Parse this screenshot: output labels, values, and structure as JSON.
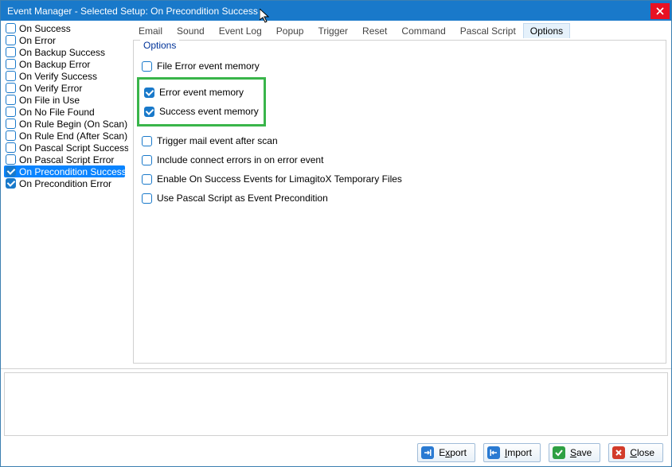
{
  "window": {
    "title": "Event Manager - Selected Setup: On Precondition Success"
  },
  "sidebar": {
    "items": [
      {
        "label": "On Success",
        "checked": false,
        "selected": false
      },
      {
        "label": "On Error",
        "checked": false,
        "selected": false
      },
      {
        "label": "On Backup Success",
        "checked": false,
        "selected": false
      },
      {
        "label": "On Backup Error",
        "checked": false,
        "selected": false
      },
      {
        "label": "On Verify Success",
        "checked": false,
        "selected": false
      },
      {
        "label": "On Verify Error",
        "checked": false,
        "selected": false
      },
      {
        "label": "On File in Use",
        "checked": false,
        "selected": false
      },
      {
        "label": "On No File Found",
        "checked": false,
        "selected": false
      },
      {
        "label": "On Rule Begin (On Scan)",
        "checked": false,
        "selected": false
      },
      {
        "label": "On Rule End (After Scan)",
        "checked": false,
        "selected": false
      },
      {
        "label": "On Pascal Script Success",
        "checked": false,
        "selected": false
      },
      {
        "label": "On Pascal Script Error",
        "checked": false,
        "selected": false
      },
      {
        "label": "On Precondition Success",
        "checked": true,
        "selected": true
      },
      {
        "label": "On Precondition Error",
        "checked": true,
        "selected": false
      }
    ]
  },
  "tabs": {
    "items": [
      {
        "label": "Email",
        "active": false
      },
      {
        "label": "Sound",
        "active": false
      },
      {
        "label": "Event Log",
        "active": false
      },
      {
        "label": "Popup",
        "active": false
      },
      {
        "label": "Trigger",
        "active": false
      },
      {
        "label": "Reset",
        "active": false
      },
      {
        "label": "Command",
        "active": false
      },
      {
        "label": "Pascal Script",
        "active": false
      },
      {
        "label": "Options",
        "active": true
      }
    ]
  },
  "options": {
    "legend": "Options",
    "rows": [
      {
        "label": "File Error event memory",
        "checked": false,
        "highlight": false
      },
      {
        "label": "Error event memory",
        "checked": true,
        "highlight": true
      },
      {
        "label": "Success event memory",
        "checked": true,
        "highlight": true
      },
      {
        "label": "Trigger mail event after scan",
        "checked": false,
        "highlight": false
      },
      {
        "label": "Include connect errors in on error event",
        "checked": false,
        "highlight": false
      },
      {
        "label": "Enable On Success Events for LimagitoX Temporary Files",
        "checked": false,
        "highlight": false
      },
      {
        "label": "Use Pascal Script as Event Precondition",
        "checked": false,
        "highlight": false
      }
    ]
  },
  "buttons": {
    "export": {
      "label": "Export",
      "accel": "x"
    },
    "import": {
      "label": "Import",
      "accel": "I"
    },
    "save": {
      "label": "Save",
      "accel": "S"
    },
    "close": {
      "label": "Close",
      "accel": "C"
    }
  }
}
